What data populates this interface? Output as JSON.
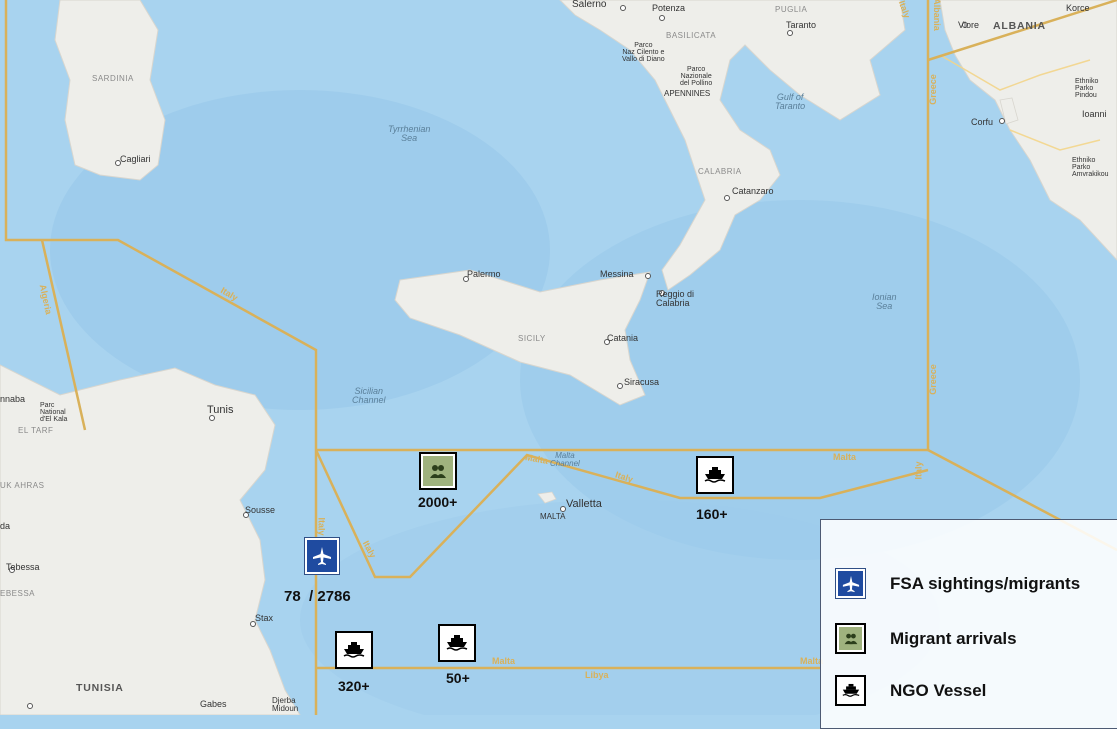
{
  "map": {
    "places": {
      "salerno": "Salerno",
      "potenza": "Potenza",
      "puglia": "PUGLIA",
      "taranto": "Taranto",
      "basilicata": "BASILICATA",
      "parco_cilento": "Parco\nNaz Cilento e\nVallo di Diano",
      "parco_pollino": "Parco\nNazionale\ndel Pollino",
      "apennines": "APENNINES",
      "gulf_taranto": "Gulf of\nTaranto",
      "sardinia": "SARDINIA",
      "cagliari": "Cagliari",
      "tyrrhenian": "Tyrrhenian\nSea",
      "calabria": "CALABRIA",
      "catanzaro": "Catanzaro",
      "palermo": "Palermo",
      "messina": "Messina",
      "reggio": "Reggio di\nCalabria",
      "ionian": "Ionian\nSea",
      "sicily": "SICILY",
      "catania": "Catania",
      "siracusa": "Siracusa",
      "sicilian_channel": "Sicilian\nChannel",
      "tunis": "Tunis",
      "malta_channel": "Malta\nChannel",
      "valletta": "Valletta",
      "malta": "MALTA",
      "sousse": "Sousse",
      "stax": "Stax",
      "gabes": "Gabes",
      "djerba": "Djerba\nMidoun",
      "tunisia": "TUNISIA",
      "albania": "ALBANIA",
      "vlore": "Vlore",
      "korce": "Korce",
      "corfu": "Corfu",
      "ioannina": "Ioanni",
      "parco_ethniko": "Ethniko\nParko\nPindou",
      "parko_ainou": "Ethniko\nParko\nAmvrakikou",
      "annaba": "nnaba",
      "parc_national": "Parc\nNational\nd'El Kala",
      "el_tarf": "EL TARF",
      "souk_ahras": "UK AHRAS",
      "tebessa": "Tebessa",
      "tebessa_region": "EBESSA",
      "da": "da"
    },
    "boundaries": {
      "italy_1": "Italy",
      "algeria": "Algeria",
      "greece_1": "Greece",
      "greece_2": "Greece",
      "albania_b": "Albania",
      "italy_top": "Italy",
      "malta_1": "Malta",
      "italy_2": "Italy",
      "italy_3": "Italy",
      "italy_4": "Italy",
      "italy_5": "Italy",
      "malta_2": "Malta",
      "libya": "Libya",
      "malta_3": "Malta",
      "malta_4": "Malta"
    }
  },
  "markers": [
    {
      "type": "migrant-arrivals",
      "icon": "group-icon",
      "count": "2000+"
    },
    {
      "type": "ngo-vessel",
      "icon": "ship-icon",
      "count": "160+"
    },
    {
      "type": "fsa-sightings",
      "icon": "airplane-icon",
      "count": "78  / 2786"
    },
    {
      "type": "ngo-vessel",
      "icon": "ship-icon",
      "count": "320+"
    },
    {
      "type": "ngo-vessel",
      "icon": "ship-icon",
      "count": "50+"
    }
  ],
  "legend": {
    "fsa": "FSA sightings/migrants",
    "migrant": "Migrant arrivals",
    "ngo": "NGO Vessel"
  },
  "colors": {
    "sea": "#a8d3ef",
    "land": "#efefec",
    "boundary": "#d9b15a",
    "fsa_blue": "#1f4ba0",
    "migrant_green": "#9fb27e"
  }
}
